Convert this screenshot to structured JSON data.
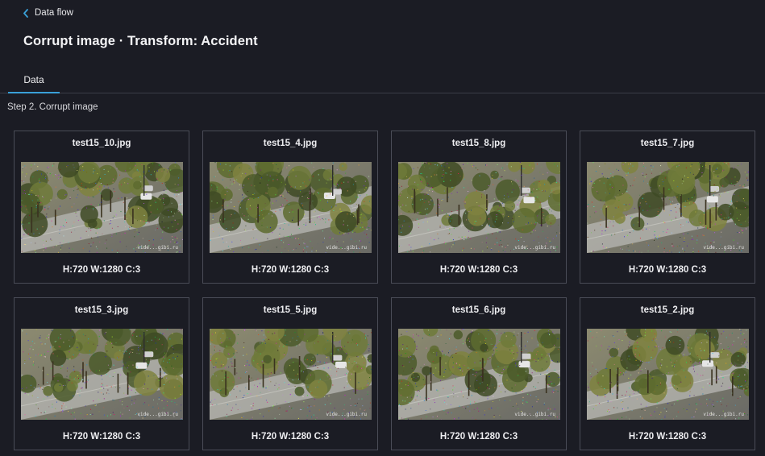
{
  "breadcrumb": {
    "back_label": "Data flow"
  },
  "page": {
    "title": "Corrupt image · Transform: Accident"
  },
  "tabs": [
    {
      "label": "Data",
      "active": true
    }
  ],
  "step": {
    "label": "Step 2. Corrupt image"
  },
  "images": [
    {
      "filename": "test15_10.jpg",
      "meta": "H:720 W:1280 C:3",
      "watermark": "vide...gibi.ru"
    },
    {
      "filename": "test15_4.jpg",
      "meta": "H:720 W:1280 C:3",
      "watermark": "vide...gibi.ru"
    },
    {
      "filename": "test15_8.jpg",
      "meta": "H:720 W:1280 C:3",
      "watermark": "vide...gibi.ru"
    },
    {
      "filename": "test15_7.jpg",
      "meta": "H:720 W:1280 C:3",
      "watermark": "vide...gibi.ru"
    },
    {
      "filename": "test15_3.jpg",
      "meta": "H:720 W:1280 C:3",
      "watermark": "vide...gibi.ru"
    },
    {
      "filename": "test15_5.jpg",
      "meta": "H:720 W:1280 C:3",
      "watermark": "vide...gibi.ru"
    },
    {
      "filename": "test15_6.jpg",
      "meta": "H:720 W:1280 C:3",
      "watermark": "vide...gibi.ru"
    },
    {
      "filename": "test15_2.jpg",
      "meta": "H:720 W:1280 C:3",
      "watermark": "vide...gibi.ru"
    }
  ],
  "colors": {
    "background": "#1b1c24",
    "accent": "#3aa0d8",
    "card_border": "#4a4c57"
  }
}
